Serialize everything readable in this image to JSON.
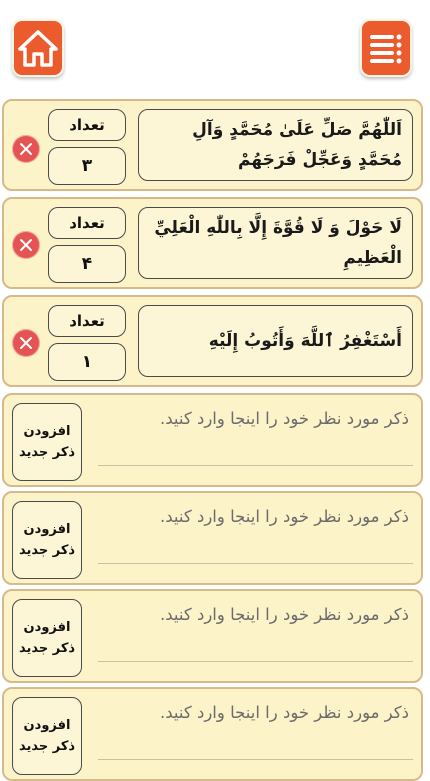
{
  "colors": {
    "accent": "#ec5b2d",
    "card_bg": "#fdf3c9",
    "card_border": "#d7b98a",
    "delete": "#e55454"
  },
  "header": {
    "home_icon": "home-icon",
    "menu_icon": "list-menu-icon"
  },
  "dhikr_items": [
    {
      "text": "اَللّٰهُمَّ صَلِّ عَلَىٰ مُحَمَّدٍ وَآلِ مُحَمَّدٍ وَعَجِّلْ فَرَجَهُمْ",
      "count_label": "تعداد",
      "count": "۳"
    },
    {
      "text": "لَا حَوْلَ وَ لَا قُوَّةَ إِلَّا بِاللّٰهِ الْعَلِيِّ الْعَظِيمِ",
      "count_label": "تعداد",
      "count": "۴"
    },
    {
      "text": "أَسْتَغْفِرُ ٱللَّهَ وَأَتُوبُ إِلَيْهِ",
      "count_label": "تعداد",
      "count": "۱"
    }
  ],
  "add_items": [
    {
      "placeholder": "ذکر مورد نظر خود را اینجا وارد کنید.",
      "button_line1": "افزودن",
      "button_line2": "ذکر جدید"
    },
    {
      "placeholder": "ذکر مورد نظر خود را اینجا وارد کنید.",
      "button_line1": "افزودن",
      "button_line2": "ذکر جدید"
    },
    {
      "placeholder": "ذکر مورد نظر خود را اینجا وارد کنید.",
      "button_line1": "افزودن",
      "button_line2": "ذکر جدید"
    },
    {
      "placeholder": "ذکر مورد نظر خود را اینجا وارد کنید.",
      "button_line1": "افزودن",
      "button_line2": "ذکر جدید"
    }
  ]
}
